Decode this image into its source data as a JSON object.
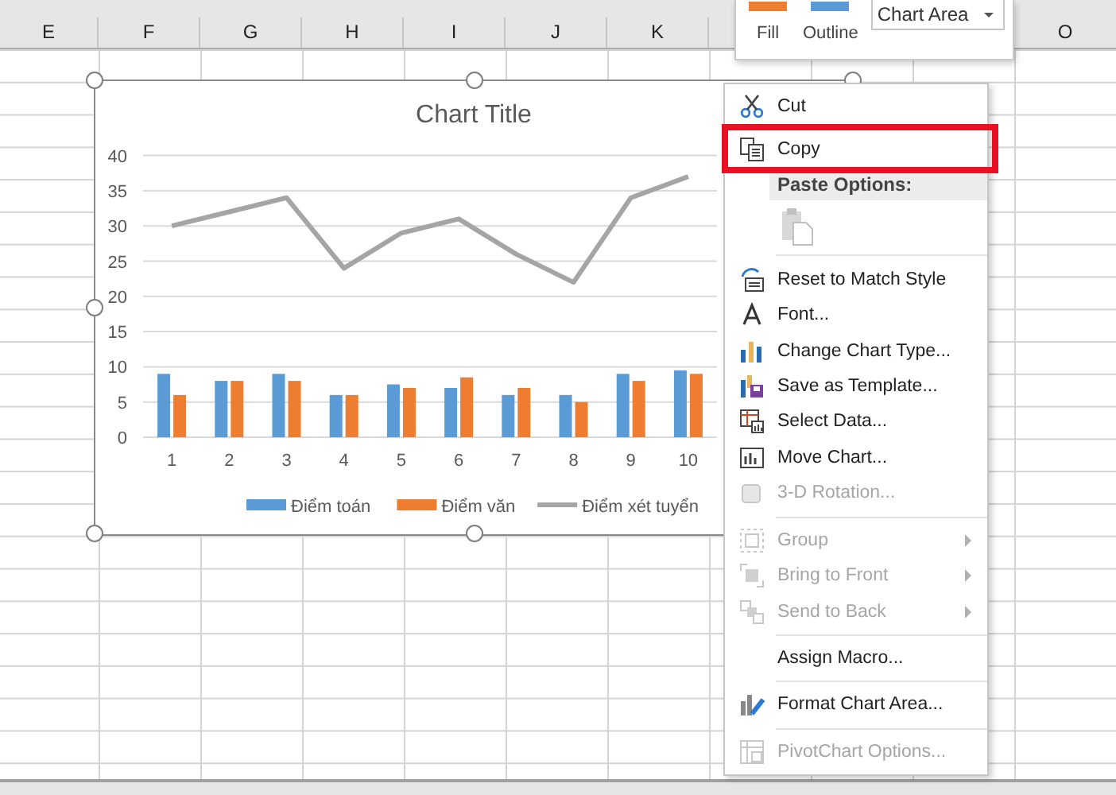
{
  "column_headers": [
    {
      "label": "E"
    },
    {
      "label": "F"
    },
    {
      "label": "G"
    },
    {
      "label": "H"
    },
    {
      "label": "I"
    },
    {
      "label": "J"
    },
    {
      "label": "K"
    },
    {
      "label": "O"
    }
  ],
  "mini_toolbar": {
    "buttons": [
      {
        "label": "Fill",
        "kind": "fill"
      },
      {
        "label": "Outline",
        "kind": "outline"
      }
    ],
    "element_dropdown": {
      "value": "Chart Area"
    }
  },
  "chart": {
    "chart_data": {
      "type": "bar",
      "title": "Chart Title",
      "categories": [
        "1",
        "2",
        "3",
        "4",
        "5",
        "6",
        "7",
        "8",
        "9",
        "10"
      ],
      "ylim": [
        0,
        40
      ],
      "grid": true,
      "legend": true,
      "yticks": [
        0,
        5,
        10,
        15,
        20,
        25,
        30,
        35,
        40
      ],
      "series": [
        {
          "name": "Điểm toán",
          "type": "bar",
          "color": "#5b9bd5",
          "values": [
            9,
            8,
            9,
            6,
            7.5,
            7,
            6,
            6,
            9,
            9.5
          ]
        },
        {
          "name": "Điểm văn",
          "type": "bar",
          "color": "#ed7d31",
          "values": [
            6,
            8,
            8,
            6,
            7,
            8.5,
            7,
            5,
            8,
            9
          ]
        },
        {
          "name": "Điểm xét tuyển",
          "type": "line",
          "color": "#a5a5a5",
          "values": [
            30,
            32,
            34,
            24,
            29,
            31,
            26,
            22,
            34,
            37
          ]
        }
      ]
    }
  },
  "context_menu": [
    {
      "kind": "item",
      "label": "Cut",
      "disabled": false,
      "highlighted": false,
      "submenu": false
    },
    {
      "kind": "item",
      "label": "Copy",
      "disabled": false,
      "highlighted": true,
      "submenu": false
    },
    {
      "kind": "header",
      "label": "Paste Options:"
    },
    {
      "kind": "paste-icons"
    },
    {
      "kind": "separator"
    },
    {
      "kind": "item",
      "label": "Reset to Match Style",
      "disabled": false,
      "highlighted": false,
      "submenu": false
    },
    {
      "kind": "item",
      "label": "Font...",
      "disabled": false,
      "highlighted": false,
      "submenu": false
    },
    {
      "kind": "item",
      "label": "Change Chart Type...",
      "disabled": false,
      "highlighted": false,
      "submenu": false
    },
    {
      "kind": "item",
      "label": "Save as Template...",
      "disabled": false,
      "highlighted": false,
      "submenu": false
    },
    {
      "kind": "item",
      "label": "Select Data...",
      "disabled": false,
      "highlighted": false,
      "submenu": false
    },
    {
      "kind": "item",
      "label": "Move Chart...",
      "disabled": false,
      "highlighted": false,
      "submenu": false
    },
    {
      "kind": "item",
      "label": "3-D Rotation...",
      "disabled": true,
      "highlighted": false,
      "submenu": false
    },
    {
      "kind": "separator"
    },
    {
      "kind": "item",
      "label": "Group",
      "disabled": true,
      "highlighted": false,
      "submenu": true
    },
    {
      "kind": "item",
      "label": "Bring to Front",
      "disabled": true,
      "highlighted": false,
      "submenu": true
    },
    {
      "kind": "item",
      "label": "Send to Back",
      "disabled": true,
      "highlighted": false,
      "submenu": true
    },
    {
      "kind": "separator"
    },
    {
      "kind": "item",
      "label": "Assign Macro...",
      "disabled": false,
      "highlighted": false,
      "submenu": false
    },
    {
      "kind": "separator"
    },
    {
      "kind": "item",
      "label": "Format Chart Area...",
      "disabled": false,
      "highlighted": false,
      "submenu": false
    },
    {
      "kind": "separator"
    },
    {
      "kind": "item",
      "label": "PivotChart Options...",
      "disabled": true,
      "highlighted": false,
      "submenu": false
    }
  ]
}
